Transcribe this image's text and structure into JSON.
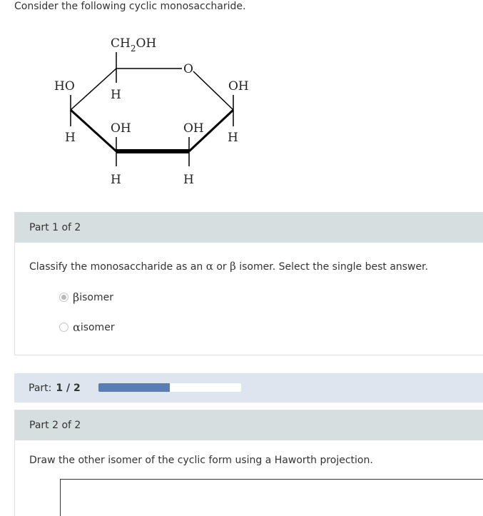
{
  "intro_text": "Consider the following cyclic monosaccharide.",
  "molecule": {
    "ring_oxygen": "O",
    "c6_group": "CH",
    "c6_sub": "2",
    "c6_oh": "OH",
    "c5_h": "H",
    "c4_ho": "HO",
    "c4_h": "H",
    "c3_oh": "OH",
    "c3_h": "H",
    "c2_oh": "OH",
    "c2_h": "H",
    "c1_oh": "OH",
    "c1_h": "H"
  },
  "part1": {
    "header": "Part 1 of 2",
    "question_prefix": "Classify the monosaccharide as an ",
    "alpha": "α",
    "question_mid": " or ",
    "beta": "β",
    "question_suffix": " isomer. Select the single best answer.",
    "options": [
      {
        "symbol": "β",
        "label": " isomer",
        "selected": true
      },
      {
        "symbol": "α",
        "label": " isomer",
        "selected": false
      }
    ]
  },
  "progress": {
    "label": "Part:",
    "count": "1 / 2",
    "fraction": 0.5,
    "color_fill": "#5a7eb3"
  },
  "part2": {
    "header": "Part 2 of 2",
    "question": "Draw the other isomer of the cyclic form using a Haworth projection."
  }
}
